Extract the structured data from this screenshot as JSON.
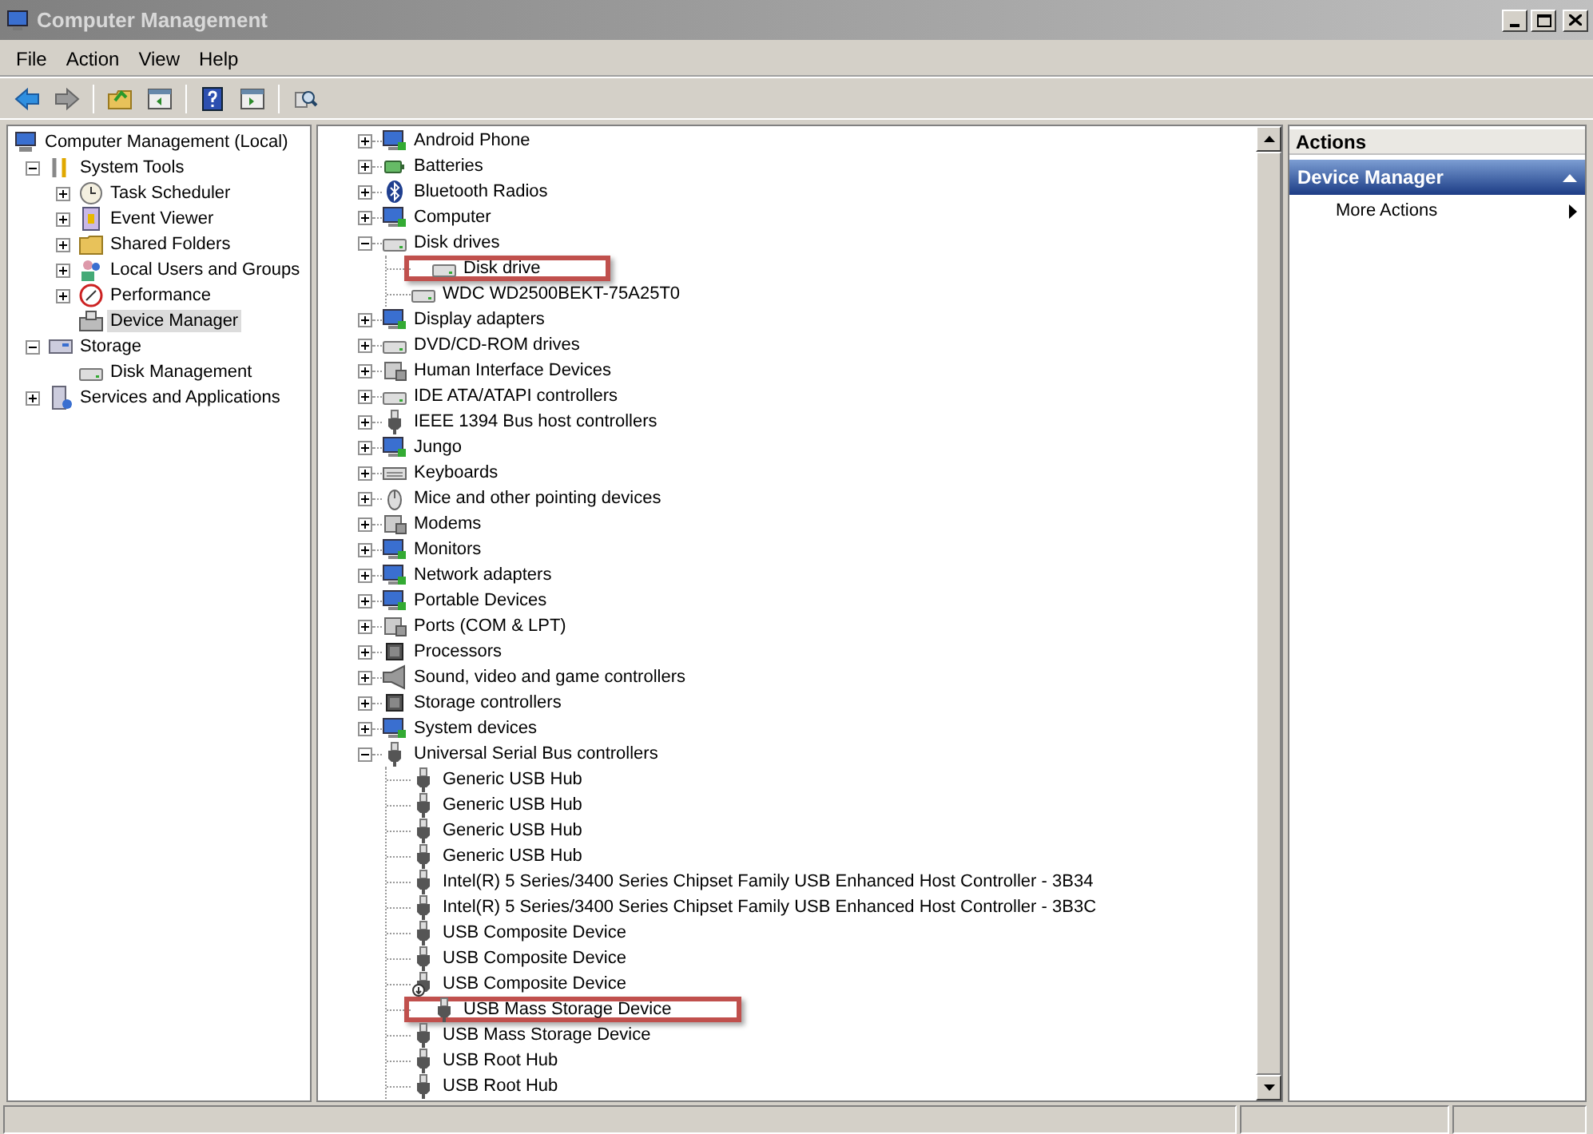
{
  "window": {
    "title": "Computer Management"
  },
  "menu": [
    "File",
    "Action",
    "View",
    "Help"
  ],
  "toolbar": [
    {
      "kind": "back"
    },
    {
      "kind": "forward"
    },
    {
      "kind": "sep"
    },
    {
      "kind": "up"
    },
    {
      "kind": "pane"
    },
    {
      "kind": "sep"
    },
    {
      "kind": "help"
    },
    {
      "kind": "pane2"
    },
    {
      "kind": "sep"
    },
    {
      "kind": "props"
    }
  ],
  "console_tree": [
    {
      "label": "Computer Management (Local)",
      "kind": "computer",
      "selected": false,
      "children": [
        {
          "label": "System Tools",
          "kind": "tools",
          "selected": false,
          "expanded": true,
          "children": [
            {
              "label": "Task Scheduler",
              "kind": "clock",
              "selected": false,
              "expanded": false
            },
            {
              "label": "Event Viewer",
              "kind": "log",
              "selected": false,
              "expanded": false
            },
            {
              "label": "Shared Folders",
              "kind": "folder",
              "selected": false,
              "expanded": false
            },
            {
              "label": "Local Users and Groups",
              "kind": "users",
              "selected": false,
              "expanded": false
            },
            {
              "label": "Performance",
              "kind": "gauge",
              "selected": false,
              "expanded": false
            },
            {
              "label": "Device Manager",
              "kind": "device",
              "selected": true
            }
          ]
        },
        {
          "label": "Storage",
          "kind": "storage",
          "selected": false,
          "expanded": true,
          "children": [
            {
              "label": "Disk Management",
              "kind": "disk",
              "selected": false
            }
          ]
        },
        {
          "label": "Services and Applications",
          "kind": "services",
          "selected": false,
          "expanded": false
        }
      ]
    }
  ],
  "devices": [
    {
      "label": "Android Phone",
      "kind": "monitor",
      "expanded": false,
      "highlighted": false
    },
    {
      "label": "Batteries",
      "kind": "battery",
      "expanded": false,
      "highlighted": false
    },
    {
      "label": "Bluetooth Radios",
      "kind": "bluetooth",
      "expanded": false,
      "highlighted": false
    },
    {
      "label": "Computer",
      "kind": "monitor",
      "expanded": false,
      "highlighted": false
    },
    {
      "label": "Disk drives",
      "kind": "disk",
      "expanded": true,
      "children": [
        {
          "label": "Disk drive",
          "kind": "disk",
          "highlighted": true
        },
        {
          "label": "WDC WD2500BEKT-75A25T0",
          "kind": "disk",
          "highlighted": false
        }
      ]
    },
    {
      "label": "Display adapters",
      "kind": "monitor",
      "expanded": false,
      "highlighted": false
    },
    {
      "label": "DVD/CD-ROM drives",
      "kind": "disk",
      "expanded": false,
      "highlighted": false
    },
    {
      "label": "Human Interface Devices",
      "kind": "hid",
      "expanded": false,
      "highlighted": false
    },
    {
      "label": "IDE ATA/ATAPI controllers",
      "kind": "disk",
      "expanded": false,
      "highlighted": false
    },
    {
      "label": "IEEE 1394 Bus host controllers",
      "kind": "usb",
      "expanded": false,
      "highlighted": false
    },
    {
      "label": "Jungo",
      "kind": "monitor",
      "expanded": false,
      "highlighted": false
    },
    {
      "label": "Keyboards",
      "kind": "keyboard",
      "expanded": false,
      "highlighted": false
    },
    {
      "label": "Mice and other pointing devices",
      "kind": "mouse",
      "expanded": false,
      "highlighted": false
    },
    {
      "label": "Modems",
      "kind": "hid",
      "expanded": false,
      "highlighted": false
    },
    {
      "label": "Monitors",
      "kind": "monitor",
      "expanded": false,
      "highlighted": false
    },
    {
      "label": "Network adapters",
      "kind": "monitor",
      "expanded": false,
      "highlighted": false
    },
    {
      "label": "Portable Devices",
      "kind": "monitor",
      "expanded": false,
      "highlighted": false
    },
    {
      "label": "Ports (COM & LPT)",
      "kind": "hid",
      "expanded": false,
      "highlighted": false
    },
    {
      "label": "Processors",
      "kind": "chip",
      "expanded": false,
      "highlighted": false
    },
    {
      "label": "Sound, video and game controllers",
      "kind": "speaker",
      "expanded": false,
      "highlighted": false
    },
    {
      "label": "Storage controllers",
      "kind": "chip",
      "expanded": false,
      "highlighted": false
    },
    {
      "label": "System devices",
      "kind": "monitor",
      "expanded": false,
      "highlighted": false
    },
    {
      "label": "Universal Serial Bus controllers",
      "kind": "usb",
      "expanded": true,
      "children": [
        {
          "label": "Generic USB Hub",
          "kind": "usb",
          "highlighted": false
        },
        {
          "label": "Generic USB Hub",
          "kind": "usb",
          "highlighted": false
        },
        {
          "label": "Generic USB Hub",
          "kind": "usb",
          "highlighted": false
        },
        {
          "label": "Generic USB Hub",
          "kind": "usb",
          "highlighted": false
        },
        {
          "label": "Intel(R) 5 Series/3400 Series Chipset Family USB Enhanced Host Controller - 3B34",
          "kind": "usb",
          "highlighted": false
        },
        {
          "label": "Intel(R) 5 Series/3400 Series Chipset Family USB Enhanced Host Controller - 3B3C",
          "kind": "usb",
          "highlighted": false
        },
        {
          "label": "USB Composite Device",
          "kind": "usb",
          "highlighted": false
        },
        {
          "label": "USB Composite Device",
          "kind": "usb",
          "highlighted": false
        },
        {
          "label": "USB Composite Device",
          "kind": "usb-warn",
          "highlighted": false
        },
        {
          "label": "USB Mass Storage Device",
          "kind": "usb",
          "highlighted": true
        },
        {
          "label": "USB Mass Storage Device",
          "kind": "usb",
          "highlighted": false
        },
        {
          "label": "USB Root Hub",
          "kind": "usb",
          "highlighted": false
        },
        {
          "label": "USB Root Hub",
          "kind": "usb",
          "highlighted": false
        }
      ]
    }
  ],
  "actions": {
    "header": "Actions",
    "section": {
      "title": "Device Manager",
      "expanded": true
    },
    "items": [
      "More Actions"
    ]
  }
}
